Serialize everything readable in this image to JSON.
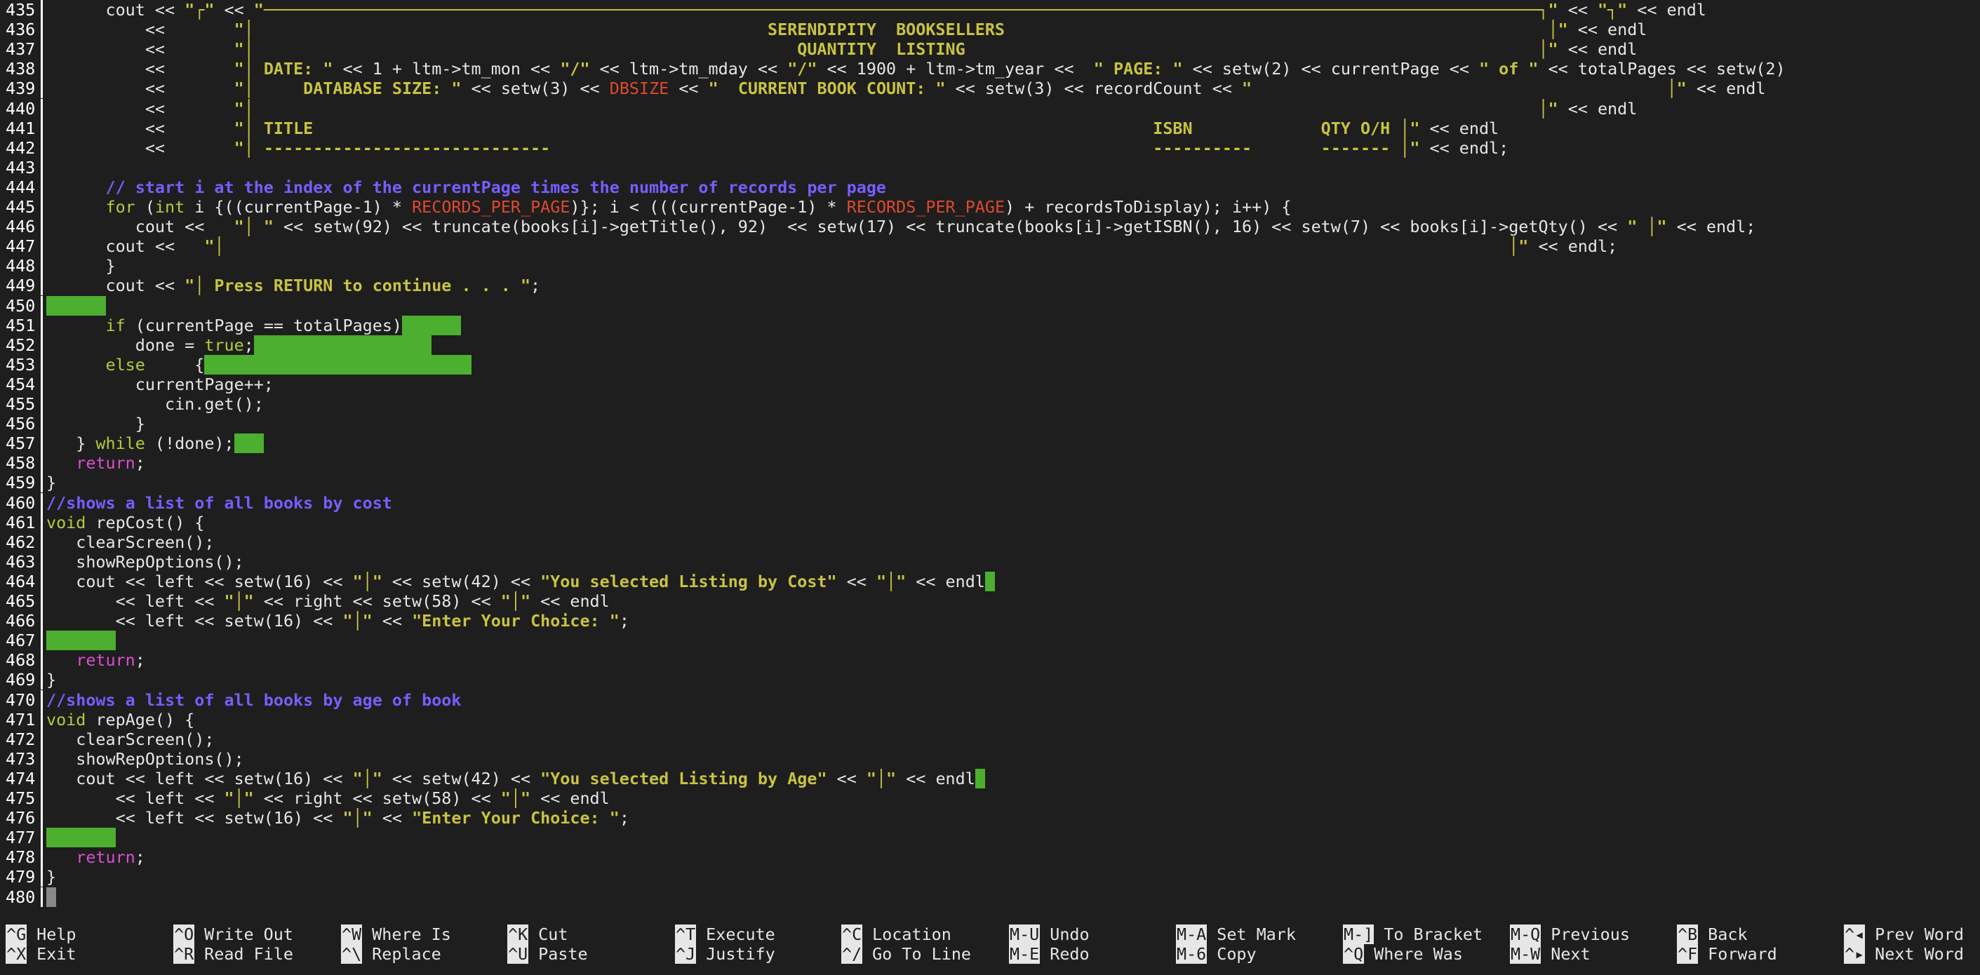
{
  "editor": {
    "lines": [
      {
        "n": "435",
        "segs": [
          [
            "d",
            "      cout << "
          ],
          [
            "s",
            "\"┌\""
          ],
          [
            "d",
            " << "
          ],
          [
            "s",
            "\"─────────────────────────────────────────────────────────────────────────────────────────────────────────────────────────────────┐\""
          ],
          [
            "d",
            " << "
          ],
          [
            "s",
            "\"┐\""
          ],
          [
            "d",
            " << endl"
          ]
        ]
      },
      {
        "n": "436",
        "segs": [
          [
            "d",
            "          <<       "
          ],
          [
            "s",
            "\"│                                                    SERENDIPITY  BOOKSELLERS                                                       │\""
          ],
          [
            "d",
            " << endl"
          ]
        ]
      },
      {
        "n": "437",
        "segs": [
          [
            "d",
            "          <<       "
          ],
          [
            "s",
            "\"│                                                       QUANTITY  LISTING                                                          │\""
          ],
          [
            "d",
            " << endl"
          ]
        ]
      },
      {
        "n": "438",
        "segs": [
          [
            "d",
            "          <<       "
          ],
          [
            "s",
            "\"│ DATE: \""
          ],
          [
            "d",
            " << 1 + ltm->tm_mon << "
          ],
          [
            "s",
            "\"/\""
          ],
          [
            "d",
            " << ltm->tm_mday << "
          ],
          [
            "s",
            "\"/\""
          ],
          [
            "d",
            " << 1900 + ltm->tm_year <<  "
          ],
          [
            "s",
            "\" PAGE: \""
          ],
          [
            "d",
            " << setw(2) << currentPage << "
          ],
          [
            "s",
            "\" of \""
          ],
          [
            "d",
            " << totalPages << setw(2)"
          ]
        ]
      },
      {
        "n": "439",
        "segs": [
          [
            "d",
            "          <<       "
          ],
          [
            "s",
            "\"│     DATABASE SIZE: \""
          ],
          [
            "d",
            " << setw(3) << "
          ],
          [
            "m",
            "DBSIZE"
          ],
          [
            "d",
            " << "
          ],
          [
            "s",
            "\"  CURRENT BOOK COUNT: \""
          ],
          [
            "d",
            " << setw(3) << recordCount << "
          ],
          [
            "s",
            "\"                                          │\""
          ],
          [
            "d",
            " << endl"
          ]
        ]
      },
      {
        "n": "440",
        "segs": [
          [
            "d",
            "          <<       "
          ],
          [
            "s",
            "\"│                                                                                                                                  │\""
          ],
          [
            "d",
            " << endl"
          ]
        ]
      },
      {
        "n": "441",
        "segs": [
          [
            "d",
            "          <<       "
          ],
          [
            "s",
            "\"│ TITLE                                                                                     ISBN             QTY O/H │\""
          ],
          [
            "d",
            " << endl"
          ]
        ]
      },
      {
        "n": "442",
        "segs": [
          [
            "d",
            "          <<       "
          ],
          [
            "s",
            "\"│ -----------------------------                                                             ----------       ------- │\""
          ],
          [
            "d",
            " << endl;"
          ]
        ]
      },
      {
        "n": "443",
        "segs": []
      },
      {
        "n": "444",
        "segs": [
          [
            "c",
            "      // start i at the index of the currentPage times the number of records per page"
          ]
        ]
      },
      {
        "n": "445",
        "segs": [
          [
            "k",
            "      for"
          ],
          [
            "d",
            " ("
          ],
          [
            "k",
            "int"
          ],
          [
            "d",
            " i {((currentPage-1) * "
          ],
          [
            "m",
            "RECORDS_PER_PAGE"
          ],
          [
            "d",
            ")}; i < (((currentPage-1) * "
          ],
          [
            "m",
            "RECORDS_PER_PAGE"
          ],
          [
            "d",
            ") + recordsToDisplay); i++) {"
          ]
        ]
      },
      {
        "n": "446",
        "segs": [
          [
            "d",
            "         cout <<   "
          ],
          [
            "s",
            "\"│ \""
          ],
          [
            "d",
            " << setw(92) << truncate(books[i]->getTitle(), 92)  << setw(17) << truncate(books[i]->getISBN(), 16) << setw(7) << books[i]->getQty() << "
          ],
          [
            "s",
            "\" │\""
          ],
          [
            "d",
            " << endl;"
          ]
        ]
      },
      {
        "n": "447",
        "segs": [
          [
            "d",
            "      cout <<   "
          ],
          [
            "s",
            "\"│                                                                                                                                  │\""
          ],
          [
            "d",
            " << endl;"
          ]
        ]
      },
      {
        "n": "448",
        "segs": [
          [
            "d",
            "      }"
          ]
        ]
      },
      {
        "n": "449",
        "segs": [
          [
            "d",
            "      cout << "
          ],
          [
            "s",
            "\"│ Press RETURN to continue . . . \""
          ],
          [
            "d",
            ";"
          ]
        ]
      },
      {
        "n": "450",
        "segs": [
          [
            "w",
            "      "
          ]
        ]
      },
      {
        "n": "451",
        "segs": [
          [
            "k",
            "      if"
          ],
          [
            "d",
            " (currentPage == totalPages)"
          ],
          [
            "w",
            "      "
          ]
        ]
      },
      {
        "n": "452",
        "segs": [
          [
            "d",
            "         done = "
          ],
          [
            "k",
            "true"
          ],
          [
            "d",
            ";"
          ],
          [
            "w",
            "                  "
          ]
        ]
      },
      {
        "n": "453",
        "segs": [
          [
            "k",
            "      else"
          ],
          [
            "d",
            "     {"
          ],
          [
            "w",
            "                           "
          ]
        ]
      },
      {
        "n": "454",
        "segs": [
          [
            "d",
            "         currentPage++;"
          ]
        ]
      },
      {
        "n": "455",
        "segs": [
          [
            "d",
            "            cin.get();"
          ]
        ]
      },
      {
        "n": "456",
        "segs": [
          [
            "d",
            "         }"
          ]
        ]
      },
      {
        "n": "457",
        "segs": [
          [
            "d",
            "   } "
          ],
          [
            "k",
            "while"
          ],
          [
            "d",
            " (!done);"
          ],
          [
            "w",
            "   "
          ]
        ]
      },
      {
        "n": "458",
        "segs": [
          [
            "r",
            "   return"
          ],
          [
            "d",
            ";"
          ]
        ]
      },
      {
        "n": "459",
        "segs": [
          [
            "d",
            "}"
          ]
        ]
      },
      {
        "n": "460",
        "segs": [
          [
            "c",
            "//shows a list of all books by cost"
          ]
        ]
      },
      {
        "n": "461",
        "segs": [
          [
            "k",
            "void"
          ],
          [
            "d",
            " repCost() {"
          ]
        ]
      },
      {
        "n": "462",
        "segs": [
          [
            "d",
            "   clearScreen();"
          ]
        ]
      },
      {
        "n": "463",
        "segs": [
          [
            "d",
            "   showRepOptions();"
          ]
        ]
      },
      {
        "n": "464",
        "segs": [
          [
            "d",
            "   cout << left << setw(16) << "
          ],
          [
            "s",
            "\"│\""
          ],
          [
            "d",
            " << setw(42) << "
          ],
          [
            "s",
            "\"You selected Listing by Cost\""
          ],
          [
            "d",
            " << "
          ],
          [
            "s",
            "\"│\""
          ],
          [
            "d",
            " << endl"
          ],
          [
            "w",
            " "
          ]
        ]
      },
      {
        "n": "465",
        "segs": [
          [
            "d",
            "       << left << "
          ],
          [
            "s",
            "\"│\""
          ],
          [
            "d",
            " << right << setw(58) << "
          ],
          [
            "s",
            "\"│\""
          ],
          [
            "d",
            " << endl"
          ]
        ]
      },
      {
        "n": "466",
        "segs": [
          [
            "d",
            "       << left << setw(16) << "
          ],
          [
            "s",
            "\"│\""
          ],
          [
            "d",
            " << "
          ],
          [
            "s",
            "\"Enter Your Choice: \""
          ],
          [
            "d",
            ";"
          ]
        ]
      },
      {
        "n": "467",
        "segs": [
          [
            "w",
            "       "
          ]
        ]
      },
      {
        "n": "468",
        "segs": [
          [
            "r",
            "   return"
          ],
          [
            "d",
            ";"
          ]
        ]
      },
      {
        "n": "469",
        "segs": [
          [
            "d",
            "}"
          ]
        ]
      },
      {
        "n": "470",
        "segs": [
          [
            "c",
            "//shows a list of all books by age of book"
          ]
        ]
      },
      {
        "n": "471",
        "segs": [
          [
            "k",
            "void"
          ],
          [
            "d",
            " repAge() {"
          ]
        ]
      },
      {
        "n": "472",
        "segs": [
          [
            "d",
            "   clearScreen();"
          ]
        ]
      },
      {
        "n": "473",
        "segs": [
          [
            "d",
            "   showRepOptions();"
          ]
        ]
      },
      {
        "n": "474",
        "segs": [
          [
            "d",
            "   cout << left << setw(16) << "
          ],
          [
            "s",
            "\"│\""
          ],
          [
            "d",
            " << setw(42) << "
          ],
          [
            "s",
            "\"You selected Listing by Age\""
          ],
          [
            "d",
            " << "
          ],
          [
            "s",
            "\"│\""
          ],
          [
            "d",
            " << endl"
          ],
          [
            "w",
            " "
          ]
        ]
      },
      {
        "n": "475",
        "segs": [
          [
            "d",
            "       << left << "
          ],
          [
            "s",
            "\"│\""
          ],
          [
            "d",
            " << right << setw(58) << "
          ],
          [
            "s",
            "\"│\""
          ],
          [
            "d",
            " << endl"
          ]
        ]
      },
      {
        "n": "476",
        "segs": [
          [
            "d",
            "       << left << setw(16) << "
          ],
          [
            "s",
            "\"│\""
          ],
          [
            "d",
            " << "
          ],
          [
            "s",
            "\"Enter Your Choice: \""
          ],
          [
            "d",
            ";"
          ]
        ]
      },
      {
        "n": "477",
        "segs": [
          [
            "w",
            "       "
          ]
        ]
      },
      {
        "n": "478",
        "segs": [
          [
            "r",
            "   return"
          ],
          [
            "d",
            ";"
          ]
        ]
      },
      {
        "n": "479",
        "segs": [
          [
            "d",
            "}"
          ]
        ]
      },
      {
        "n": "480",
        "segs": [
          [
            "cur",
            " "
          ]
        ]
      }
    ]
  },
  "shortcuts": [
    {
      "key": "^G",
      "label": "Help"
    },
    {
      "key": "^X",
      "label": "Exit"
    },
    {
      "key": "^O",
      "label": "Write Out"
    },
    {
      "key": "^R",
      "label": "Read File"
    },
    {
      "key": "^W",
      "label": "Where Is"
    },
    {
      "key": "^\\",
      "label": "Replace"
    },
    {
      "key": "^K",
      "label": "Cut"
    },
    {
      "key": "^U",
      "label": "Paste"
    },
    {
      "key": "^T",
      "label": "Execute"
    },
    {
      "key": "^J",
      "label": "Justify"
    },
    {
      "key": "^C",
      "label": "Location"
    },
    {
      "key": "^/",
      "label": "Go To Line"
    },
    {
      "key": "M-U",
      "label": "Undo"
    },
    {
      "key": "M-E",
      "label": "Redo"
    },
    {
      "key": "M-A",
      "label": "Set Mark"
    },
    {
      "key": "M-6",
      "label": "Copy"
    },
    {
      "key": "M-]",
      "label": "To Bracket"
    },
    {
      "key": "^Q",
      "label": "Where Was"
    },
    {
      "key": "M-Q",
      "label": "Previous"
    },
    {
      "key": "M-W",
      "label": "Next"
    },
    {
      "key": "^B",
      "label": "Back"
    },
    {
      "key": "^F",
      "label": "Forward"
    },
    {
      "key": "^◂",
      "label": "Prev Word"
    },
    {
      "key": "^▸",
      "label": "Next Word"
    }
  ],
  "colors": {
    "background": "#1e1e1e",
    "string": "#c8c341",
    "keyword": "#b4cb3a",
    "return": "#d94fd0",
    "comment": "#7a5cff",
    "macro": "#e0482f",
    "whitespace_highlight": "#4caf2f"
  }
}
